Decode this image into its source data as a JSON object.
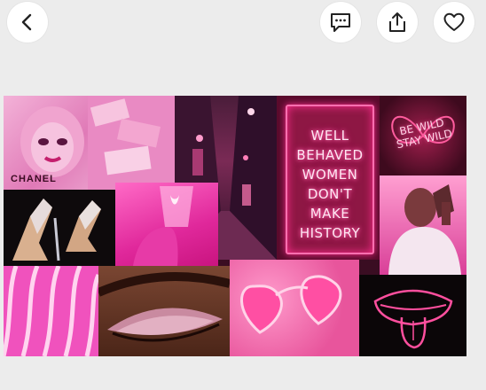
{
  "toolbar": {
    "back_icon": "chevron-left-icon",
    "comment_icon": "comment-icon",
    "share_icon": "share-icon",
    "like_icon": "heart-icon"
  },
  "collage": {
    "chanel_text": "CHANEL",
    "wild_sign": [
      "BE WILD",
      "STAY WILD"
    ],
    "neon_sign": [
      "WELL",
      "BEHAVED",
      "WOMEN",
      "DON'T",
      "MAKE",
      "HISTORY"
    ]
  },
  "colors": {
    "neon_pink": "#ff2e8f",
    "hot_pink": "#f052bd",
    "background": "#ececec"
  }
}
